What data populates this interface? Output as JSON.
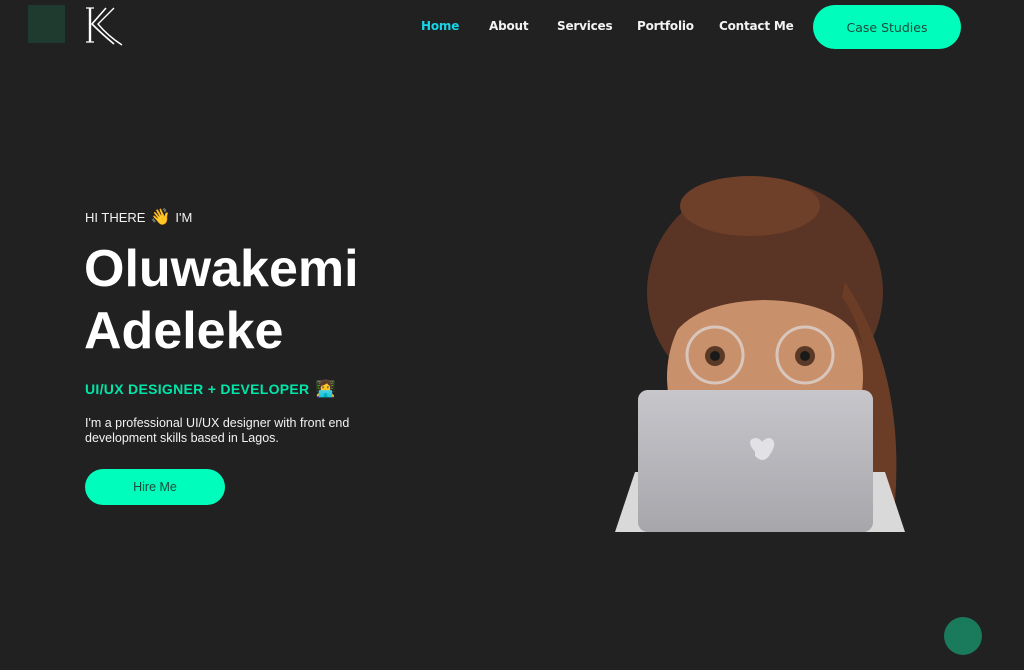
{
  "brand": {
    "logo_letter": "K",
    "colors": {
      "accent": "#00fdbb",
      "active_nav": "#19d3e6",
      "role_text": "#00e6a8",
      "background": "#212121",
      "fab": "#197a5c"
    }
  },
  "nav": {
    "items": [
      {
        "label": "Home",
        "active": true
      },
      {
        "label": "About",
        "active": false
      },
      {
        "label": "Services",
        "active": false
      },
      {
        "label": "Portfolio",
        "active": false
      },
      {
        "label": "Contact Me",
        "active": false
      }
    ],
    "cta_label": "Case Studies"
  },
  "hero": {
    "greeting_pre": "HI THERE",
    "greeting_emoji": "👋",
    "greeting_post": "I'M",
    "first_name": "Oluwakemi",
    "last_name": "Adeleke",
    "role": "UI/UX DESIGNER + DEVELOPER",
    "role_emoji": "👩‍💻",
    "description": "I'm a professional UI/UX designer with front end development skills based in Lagos.",
    "button_label": "Hire Me"
  }
}
